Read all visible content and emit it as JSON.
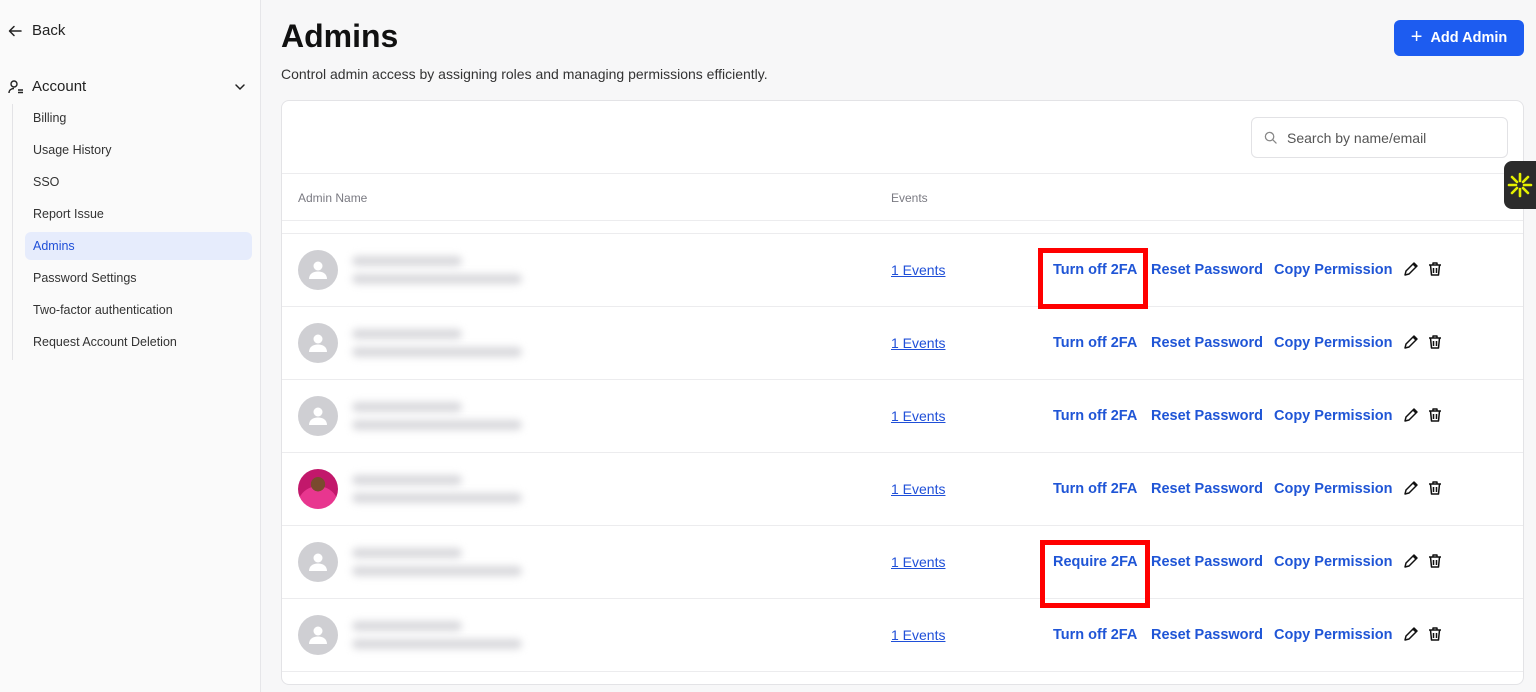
{
  "sidebar": {
    "back_label": "Back",
    "account_label": "Account",
    "items": [
      {
        "label": "Billing",
        "active": false
      },
      {
        "label": "Usage History",
        "active": false
      },
      {
        "label": "SSO",
        "active": false
      },
      {
        "label": "Report Issue",
        "active": false
      },
      {
        "label": "Admins",
        "active": true
      },
      {
        "label": "Password Settings",
        "active": false
      },
      {
        "label": "Two-factor authentication",
        "active": false
      },
      {
        "label": "Request Account Deletion",
        "active": false
      }
    ]
  },
  "header": {
    "title": "Admins",
    "subtitle": "Control admin access by assigning roles and managing permissions efficiently.",
    "add_button_label": "Add Admin"
  },
  "search": {
    "placeholder": "Search by name/email"
  },
  "table": {
    "columns": [
      "Admin Name",
      "Events"
    ],
    "rows": [
      {
        "events": "1 Events",
        "twofa_action": "Turn off 2FA",
        "reset": "Reset Password",
        "copy": "Copy Permission",
        "photo": false,
        "highlighted": true
      },
      {
        "events": "1 Events",
        "twofa_action": "Turn off 2FA",
        "reset": "Reset Password",
        "copy": "Copy Permission",
        "photo": false,
        "highlighted": false
      },
      {
        "events": "1 Events",
        "twofa_action": "Turn off 2FA",
        "reset": "Reset Password",
        "copy": "Copy Permission",
        "photo": false,
        "highlighted": false
      },
      {
        "events": "1 Events",
        "twofa_action": "Turn off 2FA",
        "reset": "Reset Password",
        "copy": "Copy Permission",
        "photo": true,
        "highlighted": false
      },
      {
        "events": "1 Events",
        "twofa_action": "Require 2FA",
        "reset": "Reset Password",
        "copy": "Copy Permission",
        "photo": false,
        "highlighted": true
      },
      {
        "events": "1 Events",
        "twofa_action": "Turn off 2FA",
        "reset": "Reset Password",
        "copy": "Copy Permission",
        "photo": false,
        "highlighted": false
      }
    ]
  },
  "colors": {
    "accent": "#1d5cf0",
    "link": "#1f55d6",
    "highlight": "#ff0000",
    "active_bg": "#e6ecfc"
  },
  "icons": [
    "arrow-left-icon",
    "user-icon",
    "chevron-down-icon",
    "plus-icon",
    "search-icon",
    "pencil-icon",
    "trash-icon",
    "sparkle-icon"
  ]
}
